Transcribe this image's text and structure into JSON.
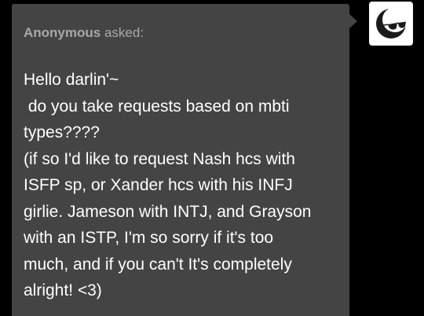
{
  "ask": {
    "asker_name": "Anonymous",
    "asked_label": "asked:",
    "message_lines": [
      "Hello darlin'~",
      " do you take requests based on mbti",
      "types????",
      "(if so I'd like to request Nash hcs with",
      "ISFP sp, or Xander hcs with his INFJ",
      "girlie. Jameson with INTJ, and Grayson",
      "with an ISTP, I'm so sorry if it's too",
      "much, and if you can't It's completely",
      "alright! <3)"
    ]
  },
  "avatar": {
    "icon": "crescent-moon-sunglasses-avatar-icon"
  },
  "colors": {
    "background": "#000000",
    "bubble": "#444444",
    "header_text": "#a8a8a8",
    "body_text": "#ffffff",
    "avatar_bg": "#ffffff",
    "avatar_moon": "#1a1a1a"
  }
}
